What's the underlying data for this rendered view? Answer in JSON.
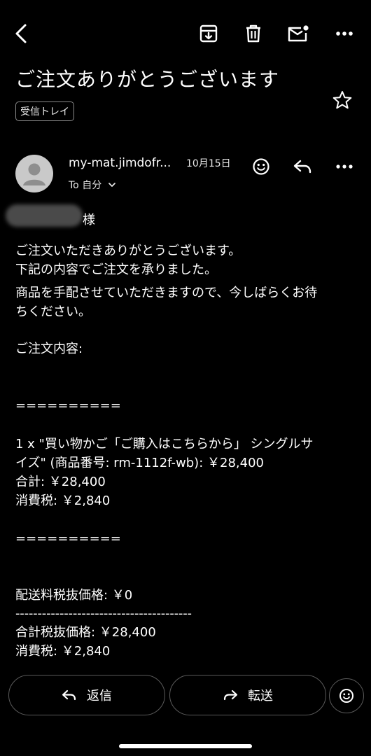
{
  "toolbar": {
    "back": "back-arrow-icon",
    "archive": "archive-icon",
    "delete": "trash-icon",
    "mark_unread": "mark-unread-icon",
    "more": "more-horizontal-icon"
  },
  "email": {
    "subject": "ご注文ありがとうございます",
    "label": "受信トレイ",
    "sender": "my-mat.jimdofr...",
    "date": "10月15日",
    "recipient_line": "To 自分",
    "salutation_suffix": "様",
    "body": {
      "p1_l1": "ご注文いただきありがとうございます。",
      "p1_l2": "下記の内容でご注文を承りました。",
      "p1_l3": "商品を手配させていただきますので、今しばらくお待",
      "p1_l4": "ちください。",
      "order_heading": "ご注文内容:",
      "divider1": "==========",
      "item_l1": "1 x \"買い物かご「ご購入はこちらから」 シングルサ",
      "item_l2": "イズ\" (商品番号: rm-1112f-wb): ￥28,400",
      "subtotal": "合計: ￥28,400",
      "tax": "消費税: ￥2,840",
      "divider2": "==========",
      "shipping": "配送料税抜価格: ￥0",
      "dashline": "----------------------------------------",
      "total_ex_tax": "合計税抜価格: ￥28,400",
      "tax2": "消費税: ￥2,840"
    }
  },
  "actions": {
    "reply_label": "返信",
    "forward_label": "転送"
  }
}
